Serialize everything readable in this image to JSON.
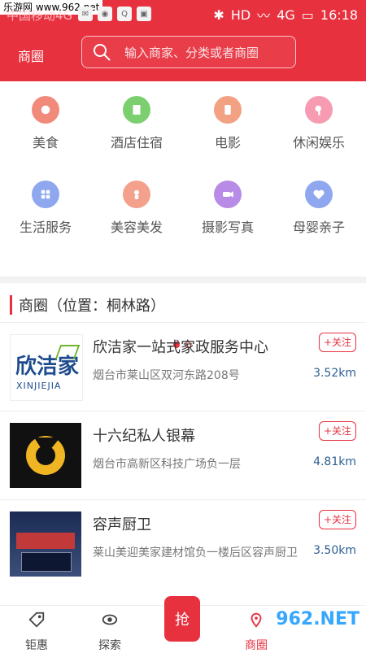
{
  "statusbar": {
    "watermark": "乐游网 www.962.net",
    "carrier": "中国移动4G",
    "time": "16:18",
    "network": "4G",
    "hd": "HD"
  },
  "appbar": {
    "district": "商圈",
    "search_placeholder": "输入商家、分类或者商圈"
  },
  "categories": [
    {
      "label": "美食",
      "color": "#f28a7c",
      "icon": "food-icon"
    },
    {
      "label": "酒店住宿",
      "color": "#7bcf6f",
      "icon": "hotel-icon"
    },
    {
      "label": "电影",
      "color": "#f2a182",
      "icon": "movie-icon"
    },
    {
      "label": "休闲娱乐",
      "color": "#f69bb2",
      "icon": "microphone-icon"
    },
    {
      "label": "生活服务",
      "color": "#8ea7ee",
      "icon": "service-icon"
    },
    {
      "label": "美容美发",
      "color": "#f3a08d",
      "icon": "beauty-icon"
    },
    {
      "label": "摄影写真",
      "color": "#b78be6",
      "icon": "camera-icon"
    },
    {
      "label": "母婴亲子",
      "color": "#8ea7ee",
      "icon": "heart-icon"
    }
  ],
  "pager": {
    "pages": 2,
    "active": 1
  },
  "section": {
    "title": "商圈（位置：桐林路）"
  },
  "shops": [
    {
      "name": "欣洁家一站式家政服务中心",
      "address": "烟台市莱山区双河东路208号",
      "distance": "3.52km",
      "follow": "+关注",
      "logo_text": "欣洁家",
      "logo_sub": "XINJIEJIA"
    },
    {
      "name": "十六纪私人银幕",
      "address": "烟台市高新区科技广场负一层",
      "distance": "4.81km",
      "follow": "+关注"
    },
    {
      "name": "容声厨卫",
      "address": "莱山美迎美家建材馆负一楼后区容声厨卫",
      "distance": "3.50km",
      "follow": "+关注"
    }
  ],
  "tabbar": {
    "items": [
      {
        "label": "钜惠",
        "icon": "tag-icon"
      },
      {
        "label": "探索",
        "icon": "eye-icon"
      },
      {
        "label": "抢",
        "icon": "grab-icon"
      },
      {
        "label": "商圈",
        "icon": "location-icon"
      }
    ],
    "brand": "962.NET"
  },
  "colors": {
    "primary": "#e8313f",
    "distance": "#2d5f91"
  }
}
